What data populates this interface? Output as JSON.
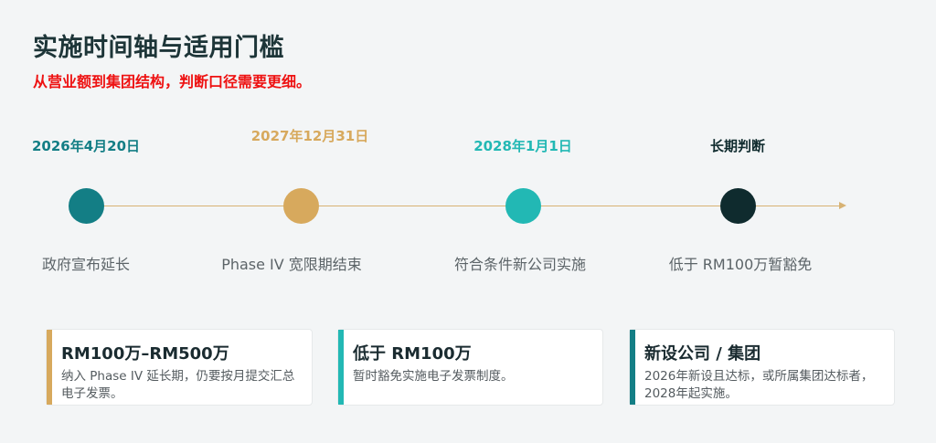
{
  "title": "实施时间轴与适用门槛",
  "subtitle": "从营业额到集团结构，判断口径需要更细。",
  "timeline": {
    "line_color": "#d7b273",
    "milestones": [
      {
        "date": "2026年4月20日",
        "label": "政府宣布延长",
        "color": "#137e85"
      },
      {
        "date": "2027年12月31日",
        "label": "Phase IV 宽限期结束",
        "color": "#d7a95d"
      },
      {
        "date": "2028年1月1日",
        "label": "符合条件新公司实施",
        "color": "#22b8b4"
      },
      {
        "date": "长期判断",
        "label": "低于 RM100万暂豁免",
        "color": "#0f2b2e"
      }
    ]
  },
  "cards": [
    {
      "title": "RM100万–RM500万",
      "desc": "纳入 Phase IV 延长期，仍要按月提交汇总电子发票。",
      "color": "#d7a95d"
    },
    {
      "title": "低于 RM100万",
      "desc": "暂时豁免实施电子发票制度。",
      "color": "#22b8b4"
    },
    {
      "title": "新设公司 / 集团",
      "desc": "2026年新设且达标，或所属集团达标者，2028年起实施。",
      "color": "#137e85"
    }
  ]
}
